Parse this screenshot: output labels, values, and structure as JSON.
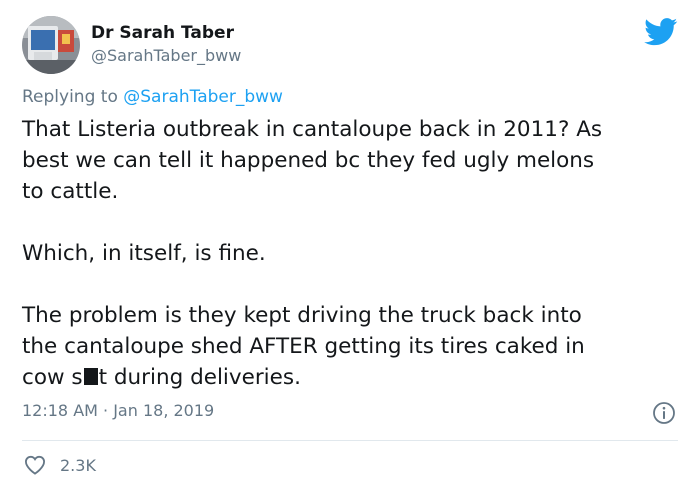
{
  "author": {
    "name": "Dr Sarah Taber",
    "handle": "@SarahTaber_bww",
    "avatar_icon": "avatar-photo"
  },
  "replying": {
    "prefix": "Replying to",
    "mention": "@SarahTaber_bww"
  },
  "tweet": {
    "lines": [
      "That Listeria outbreak in cantaloupe back in 2011? As",
      "best we can tell it happened bc they fed ugly melons",
      "to cattle.",
      "Which, in itself, is fine.",
      "The problem is they kept driving the truck back into",
      "the cantaloupe shed AFTER getting its tires caked in"
    ],
    "last_line_before": "cow s",
    "last_line_after": "t during deliveries."
  },
  "meta": {
    "timestamp": "12:18 AM · Jan 18, 2019",
    "info_icon": "info-icon"
  },
  "actions": {
    "like_count": "2.3K",
    "like_icon": "heart-icon"
  },
  "colors": {
    "brand": "#1da1f2",
    "text": "#14171a",
    "muted": "#657786",
    "divider": "#e1e8ed"
  }
}
